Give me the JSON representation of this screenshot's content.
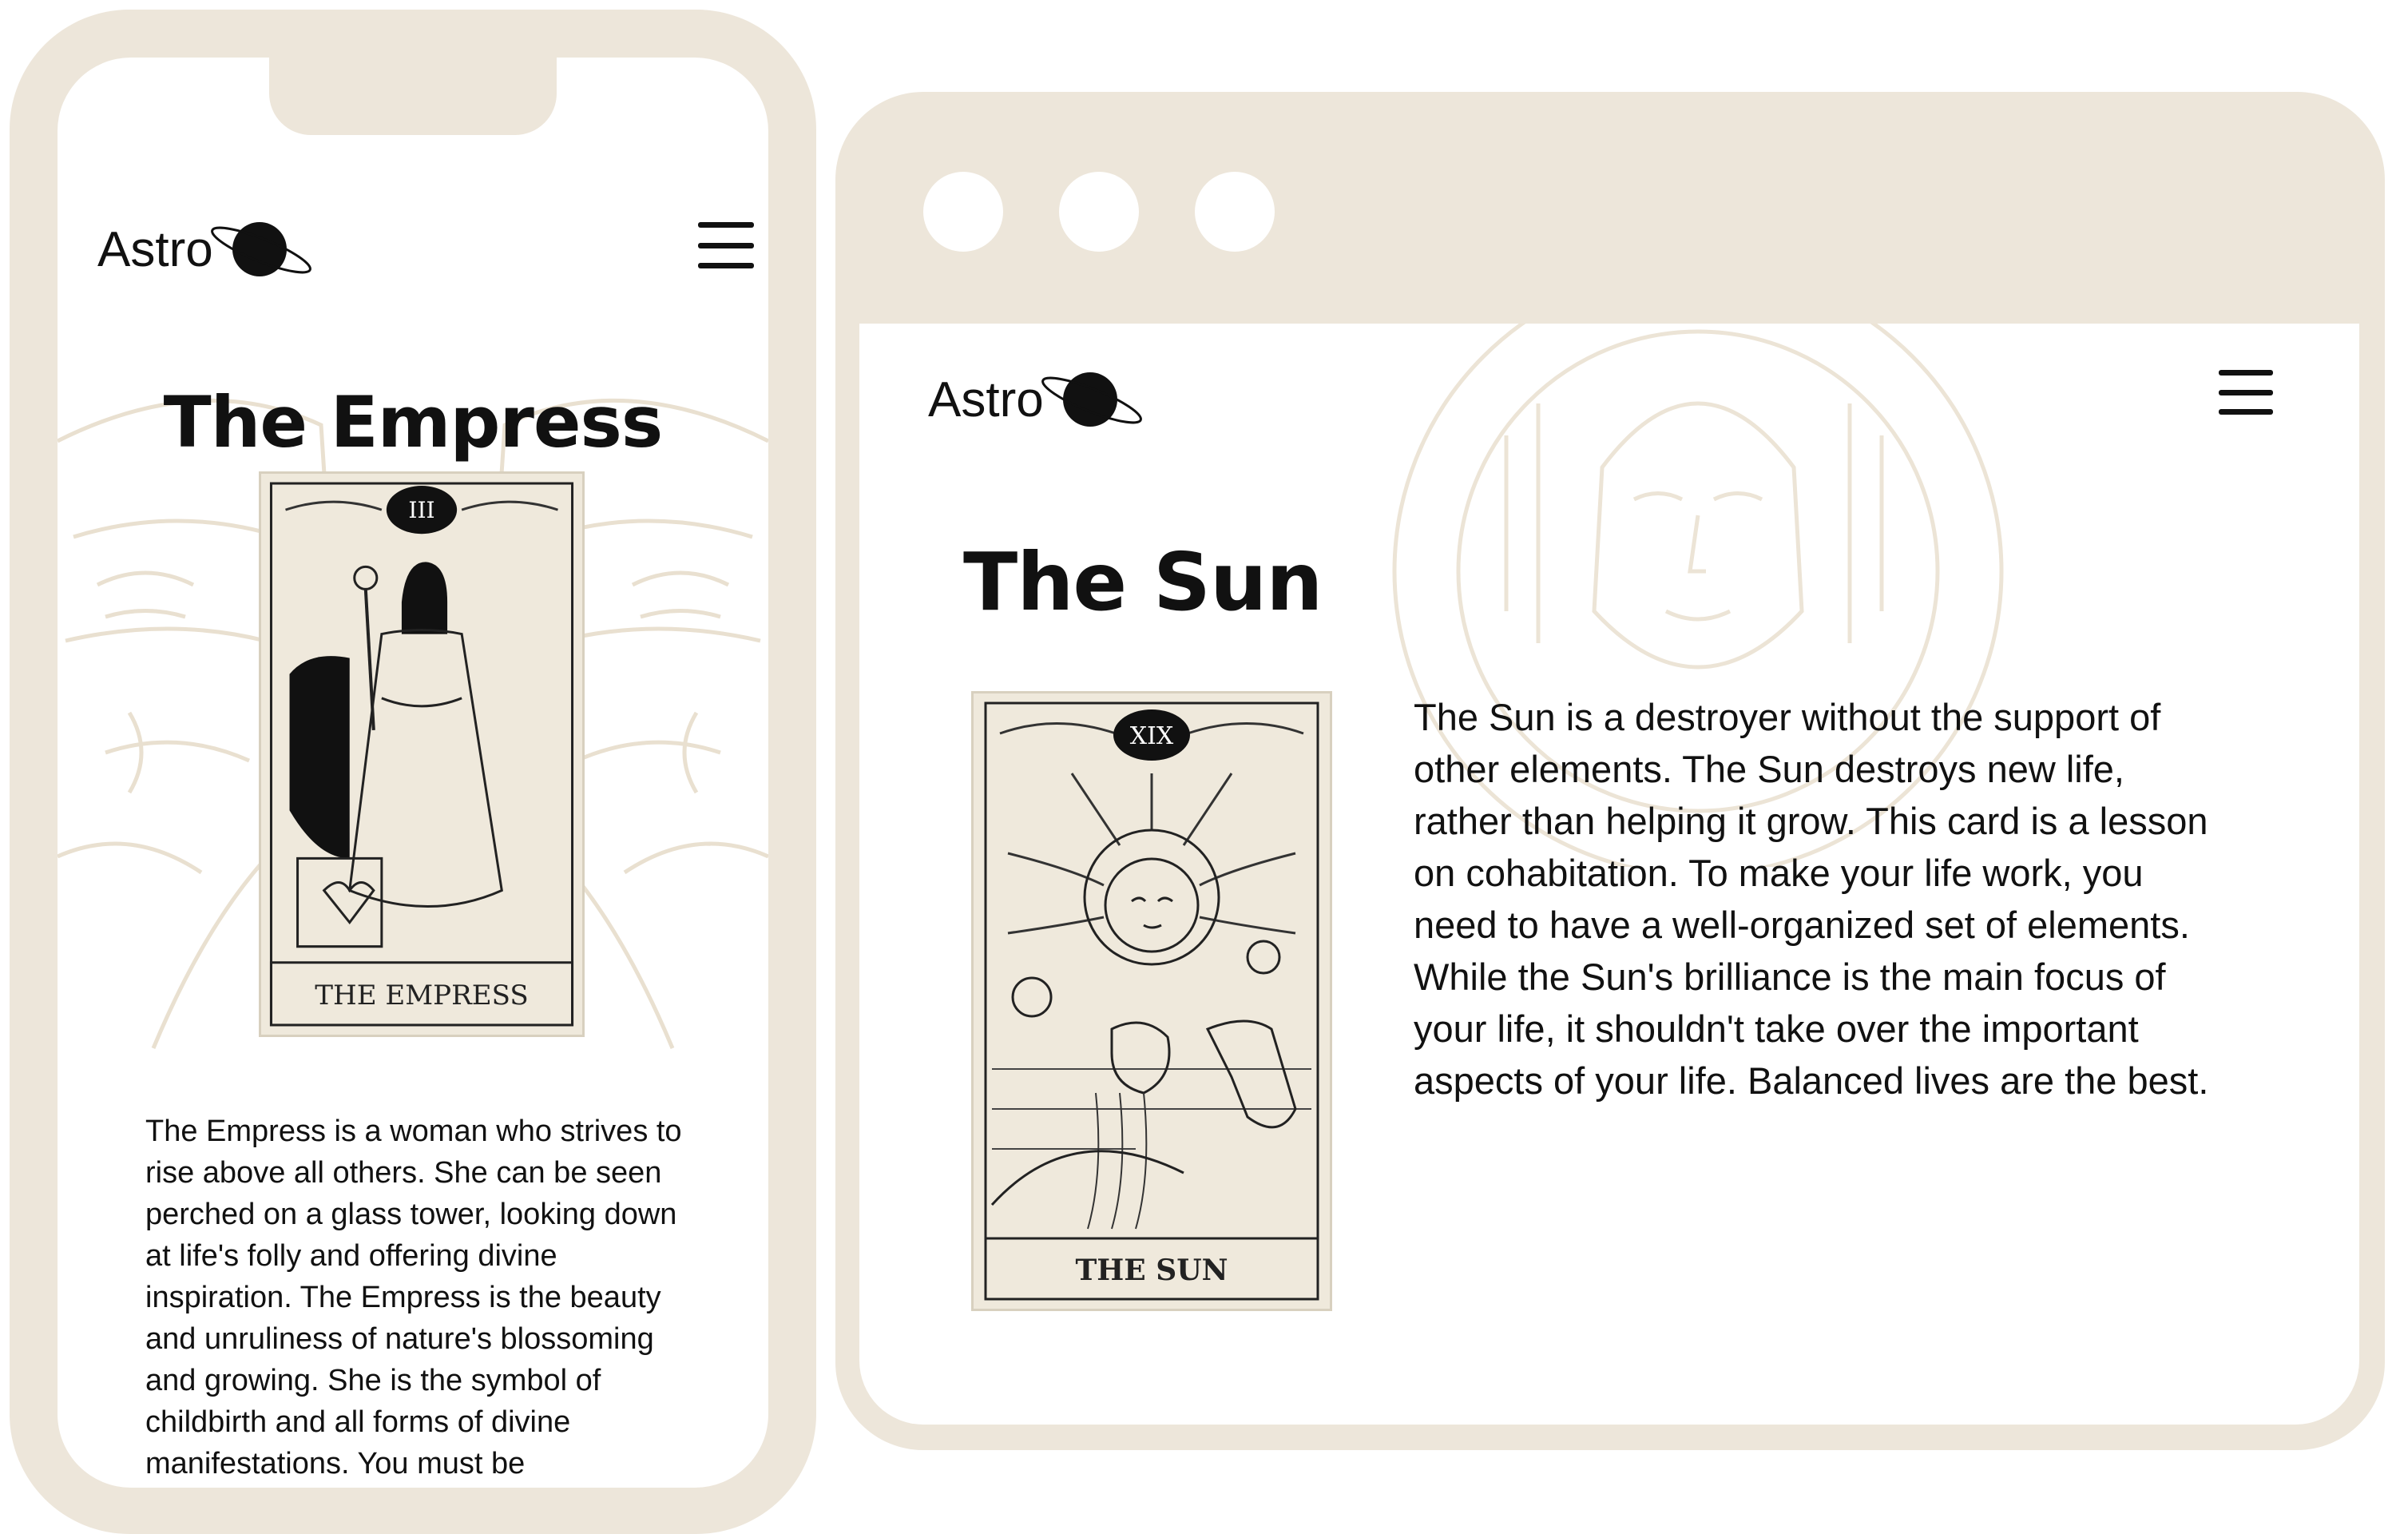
{
  "colors": {
    "frame": "#ede6da",
    "card_bg": "#efe9dc",
    "ink": "#111111",
    "art_line": "#e6dccb"
  },
  "brand": {
    "name": "Astro",
    "logo_icon": "planet-icon"
  },
  "phone": {
    "title": "The Empress",
    "card": {
      "numeral": "III",
      "label": "THE EMPRESS"
    },
    "description": "The Empress is a woman who strives to rise above all others. She can be seen perched on a glass tower, looking down at life's folly and offering divine inspiration. The Empress is the beauty and unruliness of nature's blossoming and growing. She is the symbol of childbirth and all forms of divine manifestations. You must be",
    "menu_icon": "hamburger-menu-icon"
  },
  "browser": {
    "title": "The Sun",
    "card": {
      "numeral": "XIX",
      "label": "THE SUN"
    },
    "description": "The Sun is a destroyer without the support of other elements. The Sun destroys new life, rather than helping it grow. This card is a lesson on cohabitation. To make your life work, you need to have a well-organized set of elements. While the Sun's brilliance is the main focus of your life, it shouldn't take over the important aspects of your life. Balanced lives are the best.",
    "menu_icon": "hamburger-menu-icon"
  }
}
